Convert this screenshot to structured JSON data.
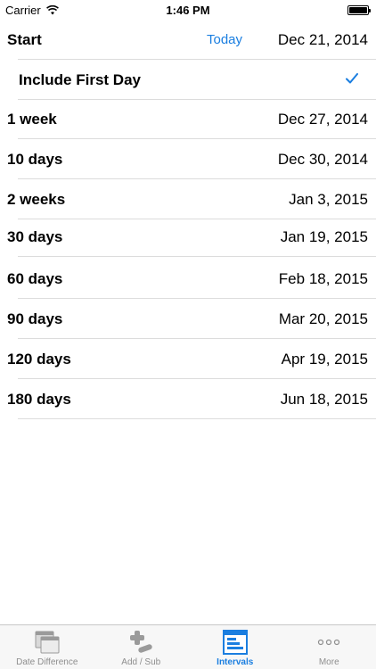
{
  "status_bar": {
    "carrier": "Carrier",
    "time": "1:46 PM"
  },
  "start": {
    "label": "Start",
    "today_button": "Today",
    "date": "Dec 21, 2014"
  },
  "include_first_day": {
    "label": "Include First Day",
    "checked": true
  },
  "intervals": [
    {
      "label": "1 week",
      "date": "Dec 27, 2014"
    },
    {
      "label": "10 days",
      "date": "Dec 30, 2014"
    },
    {
      "label": "2 weeks",
      "date": "Jan 3, 2015"
    },
    {
      "label": "30 days",
      "date": "Jan 19, 2015"
    },
    {
      "label": "60 days",
      "date": "Feb 18, 2015"
    },
    {
      "label": "90 days",
      "date": "Mar 20, 2015"
    },
    {
      "label": "120 days",
      "date": "Apr 19, 2015"
    },
    {
      "label": "180 days",
      "date": "Jun 18, 2015"
    }
  ],
  "tab_bar": {
    "tabs": [
      {
        "label": "Date Difference",
        "icon": "calendar-stack-icon",
        "active": false
      },
      {
        "label": "Add / Sub",
        "icon": "plus-minus-icon",
        "active": false
      },
      {
        "label": "Intervals",
        "icon": "intervals-icon",
        "active": true
      },
      {
        "label": "More",
        "icon": "more-dots-icon",
        "active": false
      }
    ]
  },
  "colors": {
    "accent": "#1a7ee0",
    "separator": "#dcdcdc",
    "tab_inactive": "#8e8e8e"
  }
}
